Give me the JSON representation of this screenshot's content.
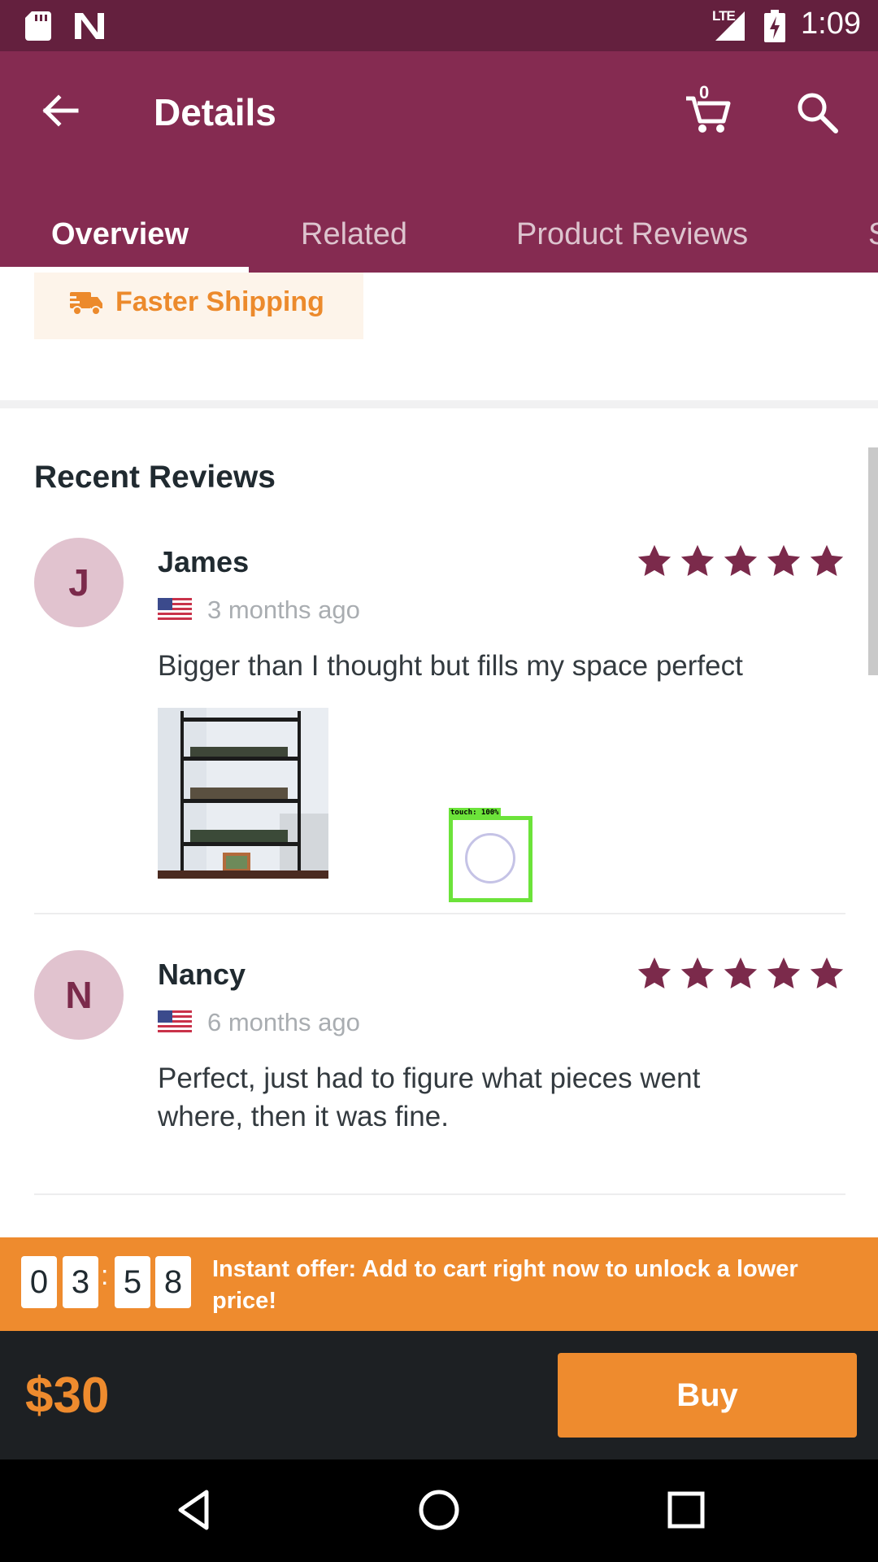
{
  "status_bar": {
    "network_label": "LTE",
    "time": "1:09"
  },
  "app_bar": {
    "title": "Details",
    "cart_count": "0"
  },
  "tabs": [
    {
      "label": "Overview",
      "active": true
    },
    {
      "label": "Related",
      "active": false
    },
    {
      "label": "Product Reviews",
      "active": false
    },
    {
      "label": "S",
      "active": false
    }
  ],
  "shipping": {
    "label": "Faster Shipping",
    "icon": "truck-icon"
  },
  "reviews_section": {
    "title": "Recent Reviews",
    "reviews": [
      {
        "initial": "J",
        "name": "James",
        "date": "3 months ago",
        "rating": 5,
        "text": "Bigger than I thought but fills my space perfect",
        "has_photo": true
      },
      {
        "initial": "N",
        "name": "Nancy",
        "date": "6 months ago",
        "rating": 5,
        "text": "Perfect, just had to figure what pieces went where, then it was fine.",
        "has_photo": false
      }
    ]
  },
  "touch_overlay": {
    "label": "touch: 100%"
  },
  "offer": {
    "timer_digits": [
      "0",
      "3",
      "5",
      "8"
    ],
    "separator": ":",
    "text": "Instant offer: Add to cart right now to unlock a lower price!"
  },
  "purchase": {
    "price": "$30",
    "buy_label": "Buy"
  },
  "colors": {
    "status_bar": "#64203e",
    "app_bar": "#852b51",
    "accent_orange": "#ee8b2e",
    "star": "#7b2a4b",
    "bottom_bar": "#1d2023"
  }
}
